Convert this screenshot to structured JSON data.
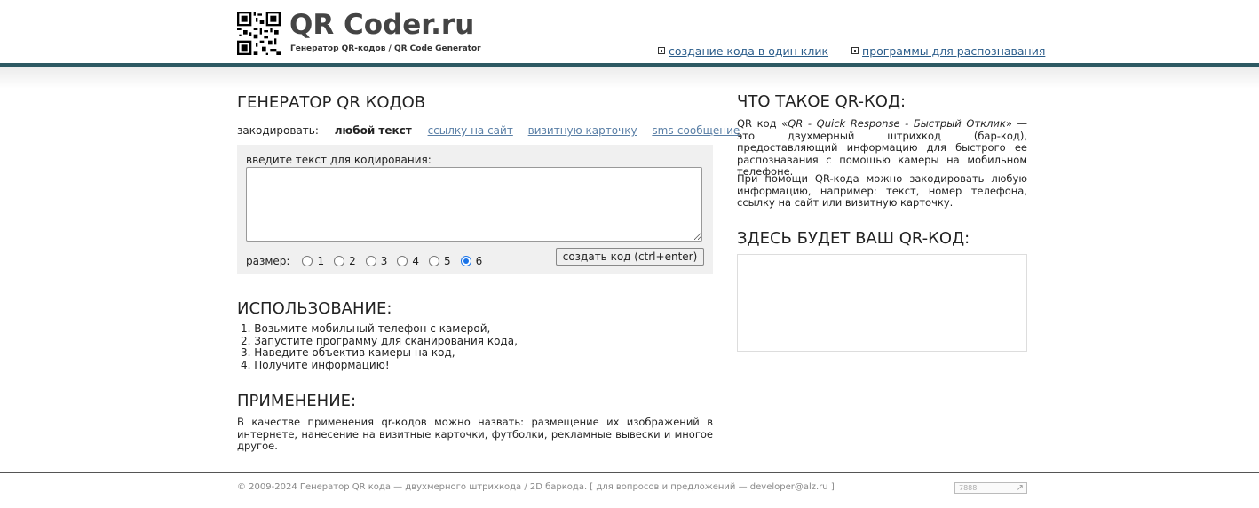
{
  "header": {
    "logo_title": "QR Coder.ru",
    "logo_subtitle": "Генератор QR-кодов / QR Code Generator",
    "links": [
      {
        "label": "создание кода в один клик"
      },
      {
        "label": "программы для распознавания"
      }
    ]
  },
  "generator": {
    "title": "ГЕНЕРАТОР QR КОДОВ",
    "encode_label": "закодировать:",
    "encode_current": "любой текст",
    "encode_options": [
      "ссылку на сайт",
      "визитную карточку",
      "sms-сообщение"
    ],
    "input_label": "введите текст для кодирования:",
    "input_value": "",
    "size_label": "размер:",
    "sizes": [
      "1",
      "2",
      "3",
      "4",
      "5",
      "6"
    ],
    "selected_size": "6",
    "submit_label": "создать код (ctrl+enter)"
  },
  "usage": {
    "title": "ИСПОЛЬЗОВАНИЕ:",
    "steps": [
      "1. Возьмите мобильный телефон с камерой,",
      "2. Запустите программу для сканирования кода,",
      "3. Наведите объектив камеры на код,",
      "4. Получите информацию!"
    ]
  },
  "application": {
    "title": "ПРИМЕНЕНИЕ:",
    "text": "В качестве применения qr-кодов можно назвать: размещение их изображений в интернете, нанесение на визитные карточки, футболки, рекламные вывески и многое другое."
  },
  "about": {
    "title": "ЧТО ТАКОЕ QR-КОД:",
    "p1_pre": "QR код «",
    "p1_em": "QR - Quick Response - Быстрый Отклик",
    "p1_post": "» — это двухмерный штрихкод (бар-код), предоставляющий информацию для быстрого ее распознавания с помощью камеры на мобильном телефоне.",
    "p2": "При помощи QR-кода можно закодировать любую информацию, например: текст, номер телефона, ссылку на сайт или визитную карточку."
  },
  "result": {
    "title": "ЗДЕСЬ БУДЕТ ВАШ QR-КОД:"
  },
  "footer": {
    "text": "© 2009-2024 Генератор QR кода — двухмерного штрихкода / 2D баркода.   [ для вопросов и предложений — developer@alz.ru ]",
    "counter_label": "7888"
  },
  "colors": {
    "accent_bar": "#2d5963",
    "link": "#2a5c8a",
    "radio_selected": "#1a73e8"
  }
}
